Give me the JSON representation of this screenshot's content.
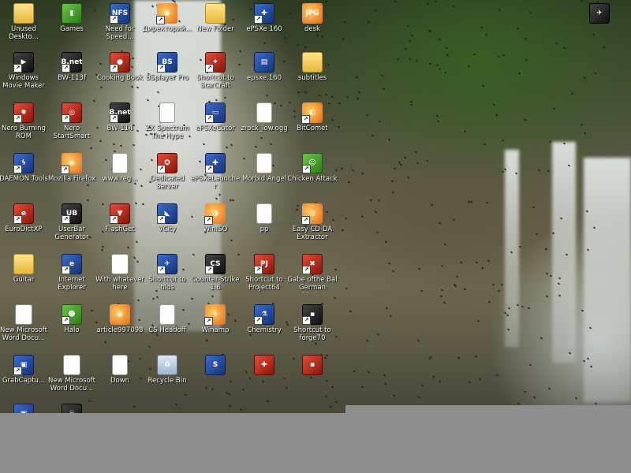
{
  "desktop": {
    "icons": [
      {
        "label": "Unused Deskto...",
        "icon": "folder-icon",
        "style": "g-folder",
        "glyph": "",
        "shortcut": false
      },
      {
        "label": "Games",
        "icon": "games-icon",
        "style": "g-green",
        "glyph": "▮",
        "shortcut": false
      },
      {
        "label": "Need for Speed...",
        "icon": "nfs-icon",
        "style": "g-app",
        "glyph": "NFS",
        "shortcut": true
      },
      {
        "label": "Директорий...",
        "icon": "firefox-icon",
        "style": "g-orange",
        "glyph": "◉",
        "shortcut": true
      },
      {
        "label": "New Folder",
        "icon": "folder-icon",
        "style": "g-folder",
        "glyph": "",
        "shortcut": false
      },
      {
        "label": "ePSXe 160",
        "icon": "gamepad-icon",
        "style": "g-app",
        "glyph": "✚",
        "shortcut": true
      },
      {
        "label": "desk",
        "icon": "jpg-image-icon",
        "style": "g-orange",
        "glyph": "JPG",
        "shortcut": false
      },
      {
        "label": "Windows Movie Maker",
        "icon": "movie-maker-icon",
        "style": "g-dark",
        "glyph": "▶",
        "shortcut": true
      },
      {
        "label": "BW-113f",
        "icon": "bnet-icon",
        "style": "g-dark",
        "glyph": "B.net",
        "shortcut": true
      },
      {
        "label": "Cooking Book",
        "icon": "strawberry-icon",
        "style": "g-red",
        "glyph": "●",
        "shortcut": true
      },
      {
        "label": "BSplayer Pro",
        "icon": "bsplayer-icon",
        "style": "g-app",
        "glyph": "BS",
        "shortcut": true
      },
      {
        "label": "Shortcut to StarCraft",
        "icon": "starcraft-icon",
        "style": "g-red",
        "glyph": "✦",
        "shortcut": true
      },
      {
        "label": "epsxe.160",
        "icon": "winrar-icon",
        "style": "g-app",
        "glyph": "▤",
        "shortcut": false
      },
      {
        "label": "subtitles",
        "icon": "folder-icon",
        "style": "g-folder",
        "glyph": "",
        "shortcut": false
      },
      {
        "label": "Nero Burning ROM",
        "icon": "nero-icon",
        "style": "g-red",
        "glyph": "✹",
        "shortcut": true
      },
      {
        "label": "Nero StartSmart",
        "icon": "nero-startsmart-icon",
        "style": "g-red",
        "glyph": "◎",
        "shortcut": true
      },
      {
        "label": "BW-114",
        "icon": "bnet-icon",
        "style": "g-dark",
        "glyph": "B.net",
        "shortcut": true
      },
      {
        "label": "ZX Spectrum The Hype",
        "icon": "document-icon",
        "style": "g-doc",
        "glyph": "≡",
        "shortcut": false
      },
      {
        "label": "ePSXeCutor",
        "icon": "application-icon",
        "style": "g-app",
        "glyph": "▭",
        "shortcut": true
      },
      {
        "label": "zrock_low.ogg",
        "icon": "audio-file-icon",
        "style": "g-doc",
        "glyph": "♪",
        "shortcut": false
      },
      {
        "label": "BitComet",
        "icon": "bitcomet-icon",
        "style": "g-orange",
        "glyph": "◐",
        "shortcut": true
      },
      {
        "label": "DAEMON Tools",
        "icon": "daemon-tools-icon",
        "style": "g-app",
        "glyph": "ϟ",
        "shortcut": true
      },
      {
        "label": "Mozilla Firefox",
        "icon": "firefox-icon",
        "style": "g-orange",
        "glyph": "◉",
        "shortcut": true
      },
      {
        "label": "www.reg...",
        "icon": "document-icon",
        "style": "g-doc",
        "glyph": "≡",
        "shortcut": false
      },
      {
        "label": "Dedicated Server",
        "icon": "server-icon",
        "style": "g-red",
        "glyph": "✪",
        "shortcut": true
      },
      {
        "label": "ePSXeLauncher",
        "icon": "gamepad-icon",
        "style": "g-app",
        "glyph": "✚",
        "shortcut": true
      },
      {
        "label": "Morbid Angel",
        "icon": "text-file-icon",
        "style": "g-doc",
        "glyph": "≡",
        "shortcut": false
      },
      {
        "label": "Chicken Attack",
        "icon": "chicken-icon",
        "style": "g-green",
        "glyph": "☺",
        "shortcut": true
      },
      {
        "label": "EuroDictXP",
        "icon": "dictionary-icon",
        "style": "g-red",
        "glyph": "e",
        "shortcut": true
      },
      {
        "label": "UserBar Generator",
        "icon": "userbar-icon",
        "style": "g-dark",
        "glyph": "UB",
        "shortcut": true
      },
      {
        "label": "FlashGet",
        "icon": "flashget-icon",
        "style": "g-red",
        "glyph": "▼",
        "shortcut": true
      },
      {
        "label": "VCity",
        "icon": "vcity-icon",
        "style": "g-app",
        "glyph": "◣",
        "shortcut": true
      },
      {
        "label": "WinISO",
        "icon": "winiso-icon",
        "style": "g-orange",
        "glyph": "◑",
        "shortcut": true
      },
      {
        "label": "pp",
        "icon": "text-file-icon",
        "style": "g-doc",
        "glyph": "≡",
        "shortcut": false
      },
      {
        "label": "Easy CD-DA Extractor",
        "icon": "cd-icon",
        "style": "g-orange",
        "glyph": "◎",
        "shortcut": true
      },
      {
        "label": "Guitar",
        "icon": "folder-icon",
        "style": "g-folder",
        "glyph": "",
        "shortcut": false
      },
      {
        "label": "Internet Explorer",
        "icon": "internet-explorer-icon",
        "style": "g-app",
        "glyph": "e",
        "shortcut": true
      },
      {
        "label": "With whatever here",
        "icon": "word-document-icon",
        "style": "g-word",
        "glyph": "W",
        "shortcut": false
      },
      {
        "label": "Shortcut to hlds",
        "icon": "hlds-icon",
        "style": "g-app",
        "glyph": "✈",
        "shortcut": true
      },
      {
        "label": "Counter-Strike 1.6",
        "icon": "counter-strike-icon",
        "style": "g-dark",
        "glyph": "CS",
        "shortcut": true
      },
      {
        "label": "Shortcut to Project64",
        "icon": "project64-icon",
        "style": "g-red",
        "glyph": "PJ",
        "shortcut": true
      },
      {
        "label": "Gabe ofthe Bal German Dicti...",
        "icon": "dictionary-icon",
        "style": "g-red",
        "glyph": "✖",
        "shortcut": true
      },
      {
        "label": "New Microsoft Word Docu...",
        "icon": "word-document-icon",
        "style": "g-word",
        "glyph": "W",
        "shortcut": false
      },
      {
        "label": "Halo",
        "icon": "halo-icon",
        "style": "g-green",
        "glyph": "☻",
        "shortcut": true
      },
      {
        "label": "article997098",
        "icon": "firefox-icon",
        "style": "g-orange",
        "glyph": "◉",
        "shortcut": false
      },
      {
        "label": "CS Headoff",
        "icon": "text-file-icon",
        "style": "g-doc",
        "glyph": "≡",
        "shortcut": false
      },
      {
        "label": "Winamp",
        "icon": "winamp-icon",
        "style": "g-orange",
        "glyph": "ϟ",
        "shortcut": true
      },
      {
        "label": "Chemistry",
        "icon": "chemistry-icon",
        "style": "g-app",
        "glyph": "⚗",
        "shortcut": true
      },
      {
        "label": "Shortcut to forge70",
        "icon": "shortcut-icon",
        "style": "g-dark",
        "glyph": "▪",
        "shortcut": true
      },
      {
        "label": "GrabCaptu...",
        "icon": "grabcapture-icon",
        "style": "g-app",
        "glyph": "▣",
        "shortcut": true
      },
      {
        "label": "New Microsoft Word Docu...",
        "icon": "word-document-icon",
        "style": "g-word",
        "glyph": "W",
        "shortcut": false
      },
      {
        "label": "Down",
        "icon": "text-file-icon",
        "style": "g-doc",
        "glyph": "≡",
        "shortcut": false
      },
      {
        "label": "Recycle Bin",
        "icon": "recycle-bin-icon",
        "style": "g-recycle",
        "glyph": "♻",
        "shortcut": false
      },
      {
        "label": "",
        "icon": "skype-icon",
        "style": "g-app",
        "glyph": "S",
        "shortcut": false
      },
      {
        "label": "",
        "icon": "uk-flag-icon",
        "style": "g-red",
        "glyph": "✚",
        "shortcut": false
      },
      {
        "label": "",
        "icon": "application-icon",
        "style": "g-red",
        "glyph": "▪",
        "shortcut": false
      },
      {
        "label": "",
        "icon": "game-icon",
        "style": "g-dark",
        "glyph": "✈",
        "shortcut": false
      },
      {
        "label": "",
        "icon": "application-icon",
        "style": "g-app",
        "glyph": "▣",
        "shortcut": false
      },
      {
        "label": "",
        "icon": "skull-icon",
        "style": "g-dark",
        "glyph": "☠",
        "shortcut": false
      }
    ]
  }
}
